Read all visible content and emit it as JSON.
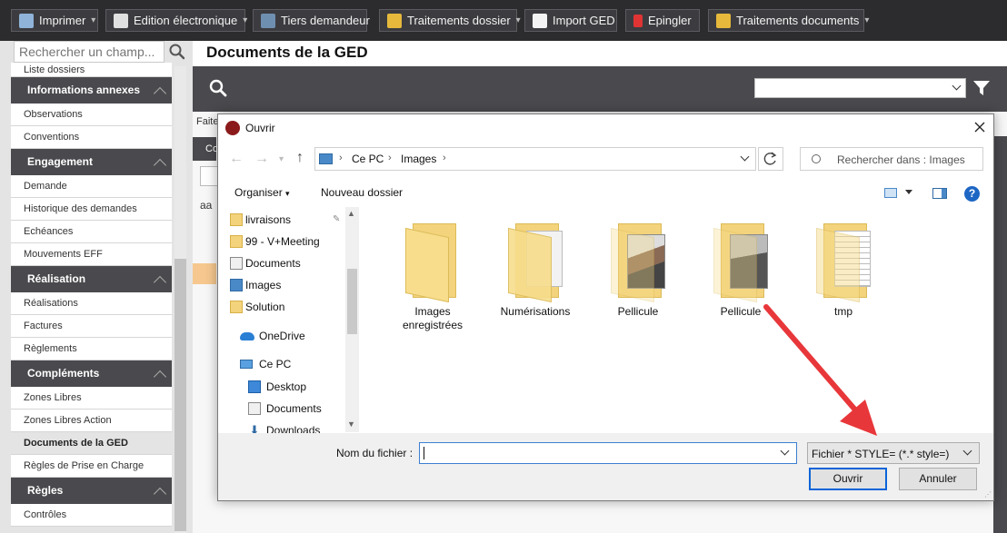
{
  "toolbar": {
    "buttons": [
      {
        "label": "Imprimer",
        "icon": "printer-icon",
        "caret": true
      },
      {
        "label": "Edition électronique",
        "icon": "document-edit-icon",
        "caret": true
      },
      {
        "label": "Tiers demandeur",
        "icon": "person-icon",
        "caret": false
      },
      {
        "label": "Traitements dossier",
        "icon": "process-icon",
        "caret": true
      },
      {
        "label": "Import GED",
        "icon": "import-icon",
        "caret": false
      },
      {
        "label": "Epingler",
        "icon": "pin-icon",
        "caret": false
      },
      {
        "label": "Traitements documents",
        "icon": "process-icon",
        "caret": true
      }
    ]
  },
  "sidebar": {
    "search_placeholder": "Rechercher un champ...",
    "sections": [
      {
        "type": "item",
        "label": "Liste dossiers"
      },
      {
        "type": "head",
        "label": "Informations annexes"
      },
      {
        "type": "item",
        "label": "Observations"
      },
      {
        "type": "item",
        "label": "Conventions"
      },
      {
        "type": "head",
        "label": "Engagement"
      },
      {
        "type": "item",
        "label": "Demande"
      },
      {
        "type": "item",
        "label": "Historique des demandes"
      },
      {
        "type": "item",
        "label": "Echéances"
      },
      {
        "type": "item",
        "label": "Mouvements EFF"
      },
      {
        "type": "head",
        "label": "Réalisation"
      },
      {
        "type": "item",
        "label": "Réalisations"
      },
      {
        "type": "item",
        "label": "Factures"
      },
      {
        "type": "item",
        "label": "Règlements"
      },
      {
        "type": "head",
        "label": "Compléments"
      },
      {
        "type": "item",
        "label": "Zones Libres"
      },
      {
        "type": "item",
        "label": "Zones Libres Action"
      },
      {
        "type": "item",
        "label": "Documents de la GED",
        "active": true
      },
      {
        "type": "item",
        "label": "Règles de Prise en Charge"
      },
      {
        "type": "head",
        "label": "Règles"
      },
      {
        "type": "item",
        "label": "Contrôles"
      }
    ]
  },
  "main": {
    "title": "Documents de la GED",
    "fragment_faite": "Faite",
    "fragment_co": "Co",
    "fragment_aa": "aa"
  },
  "dialog": {
    "title": "Ouvrir",
    "breadcrumb": [
      "Ce PC",
      "Images"
    ],
    "search_placeholder": "Rechercher dans : Images",
    "organize_label": "Organiser",
    "new_folder_label": "Nouveau dossier",
    "nav_items": [
      {
        "label": "livraisons",
        "icon": "folder",
        "pinned": true
      },
      {
        "label": "99 - V+Meeting",
        "icon": "folder"
      },
      {
        "label": "Documents",
        "icon": "doc"
      },
      {
        "label": "Images",
        "icon": "img"
      },
      {
        "label": "Solution",
        "icon": "folder"
      },
      {
        "label": "OneDrive",
        "icon": "cloud"
      },
      {
        "label": "Ce PC",
        "icon": "pc"
      },
      {
        "label": "Desktop",
        "icon": "desk"
      },
      {
        "label": "Documents",
        "icon": "doc"
      },
      {
        "label": "Downloads",
        "icon": "dl"
      }
    ],
    "files": [
      {
        "label": "Images enregistrées",
        "kind": "folder"
      },
      {
        "label": "Numérisations",
        "kind": "paper"
      },
      {
        "label": "Pellicule",
        "kind": "photo"
      },
      {
        "label": "Pellicule",
        "kind": "photo"
      },
      {
        "label": "tmp",
        "kind": "paper"
      }
    ],
    "filename_label": "Nom du fichier :",
    "filename_value": "",
    "filetype_value": "Fichier * STYLE= (*.* style=)",
    "open_label": "Ouvrir",
    "cancel_label": "Annuler"
  },
  "colors": {
    "toolbar_bg": "#2c2c2f",
    "section_head_bg": "#4a4a4e",
    "arrow": "#e8373a",
    "primary_border": "#0a64d8"
  }
}
